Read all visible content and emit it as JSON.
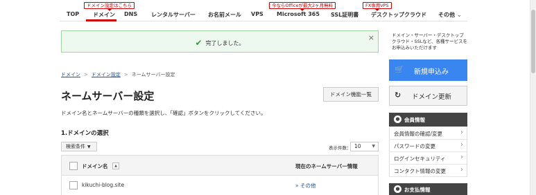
{
  "nav": {
    "items": [
      {
        "label": "TOP"
      },
      {
        "label": "ドメイン"
      },
      {
        "label": "DNS"
      },
      {
        "label": "レンタルサーバー"
      },
      {
        "label": "お名前メール"
      },
      {
        "label": "VPS"
      },
      {
        "label": "Microsoft 365"
      },
      {
        "label": "SSL証明書"
      },
      {
        "label": "デスクトップクラウド"
      },
      {
        "label": "その他"
      }
    ],
    "tags": [
      {
        "label": "ドメイン設定はこちら"
      },
      {
        "label": "今ならOfficeが最大2ヶ月無料"
      },
      {
        "label": "FX専用VPS"
      }
    ],
    "accent_color": "#cc0000"
  },
  "success": {
    "message": "完了しました。",
    "close": "×"
  },
  "breadcrumb": {
    "items": [
      "ドメイン",
      "ドメイン設定",
      "ネームサーバー設定"
    ],
    "separator": ">"
  },
  "page": {
    "title": "ネームサーバー設定",
    "domain_func_button": "ドメイン機能一覧",
    "description": "ドメイン名とネームサーバーの種類を選択し、「確認」ボタンをクリックしてください。",
    "section_title": "1.ドメインの選択"
  },
  "filter": {
    "label": "検索条件",
    "per_page_label": "表示件数：",
    "per_page_value": "10"
  },
  "table": {
    "col_domain": "ドメイン名",
    "col_nameserver": "現在のネームサーバー情報",
    "sort_symbol": "▲",
    "rows": [
      {
        "domain": "kikuchi-blog.site",
        "nameserver": "» その他"
      }
    ]
  },
  "sidebar": {
    "note": "ドメイン・サーバー・デスクトップクラウド・SSLなど、各種サービスをお申込みいただけます",
    "apply_button": "新規申込み",
    "renew_button": "ドメイン更新",
    "member_panel": {
      "title": "会員情報",
      "items": [
        "会員情報の確認/変更",
        "パスワードの変更",
        "ログインセキュリティ",
        "コンタクト情報の変更"
      ]
    },
    "payment_panel": {
      "title": "お支払情報"
    },
    "apply_color": "#3a86f0"
  }
}
